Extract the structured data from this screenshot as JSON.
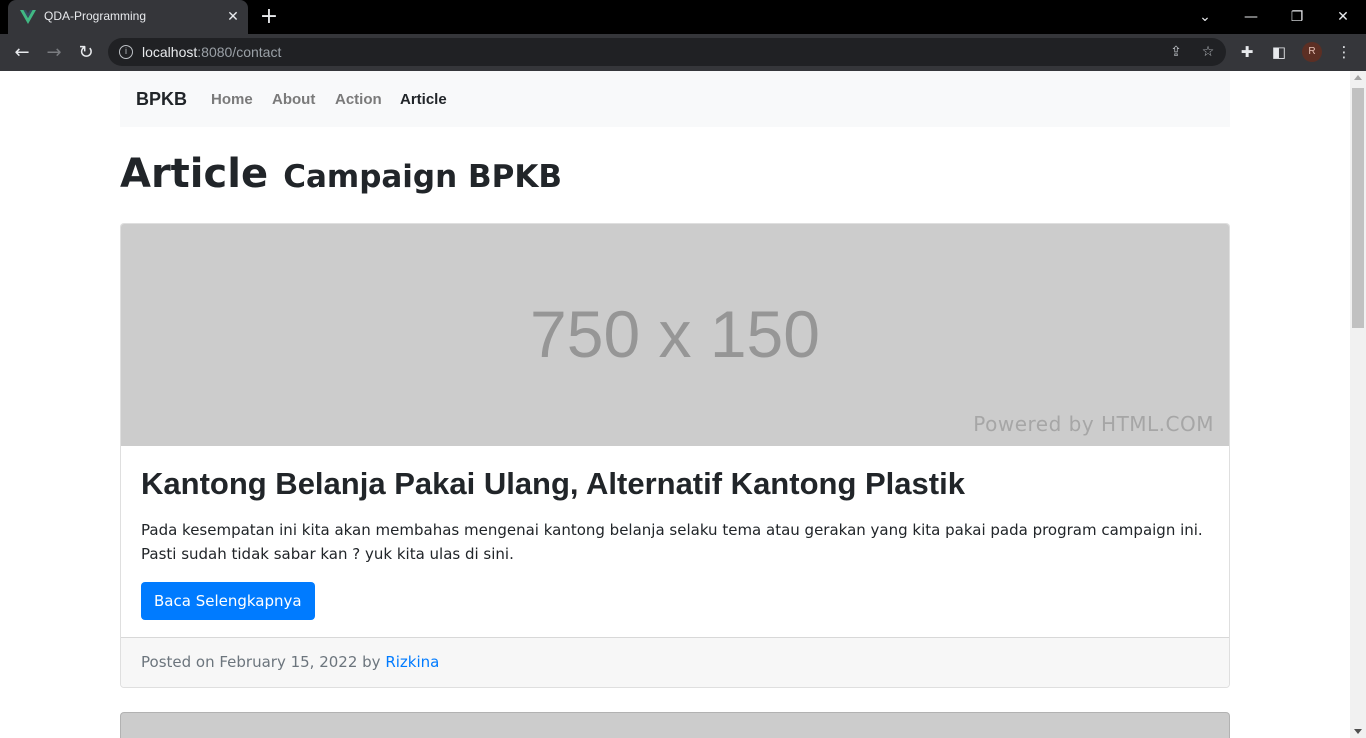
{
  "browser": {
    "tab_title": "QDA-Programming",
    "url_host": "localhost",
    "url_path": ":8080/contact",
    "profile_initial": "R"
  },
  "navbar": {
    "brand": "BPKB",
    "links": [
      "Home",
      "About",
      "Action",
      "Article"
    ],
    "active": "Article"
  },
  "page": {
    "heading": "Article",
    "subheading": "Campaign BPKB"
  },
  "article": {
    "image_size_text": "750 x 150",
    "image_powered_text": "Powered by HTML.COM",
    "title": "Kantong Belanja Pakai Ulang, Alternatif Kantong Plastik",
    "text": "Pada kesempatan ini kita akan membahas mengenai kantong belanja selaku tema atau gerakan yang kita pakai pada program campaign ini. Pasti sudah tidak sabar kan ? yuk kita ulas di sini.",
    "button_label": "Baca Selengkapnya",
    "footer_prefix": "Posted on February 15, 2022 by ",
    "author": "Rizkina"
  },
  "colors": {
    "primary": "#007bff",
    "navbar_bg": "#f8f9fa",
    "placeholder_bg": "#cccccc"
  }
}
